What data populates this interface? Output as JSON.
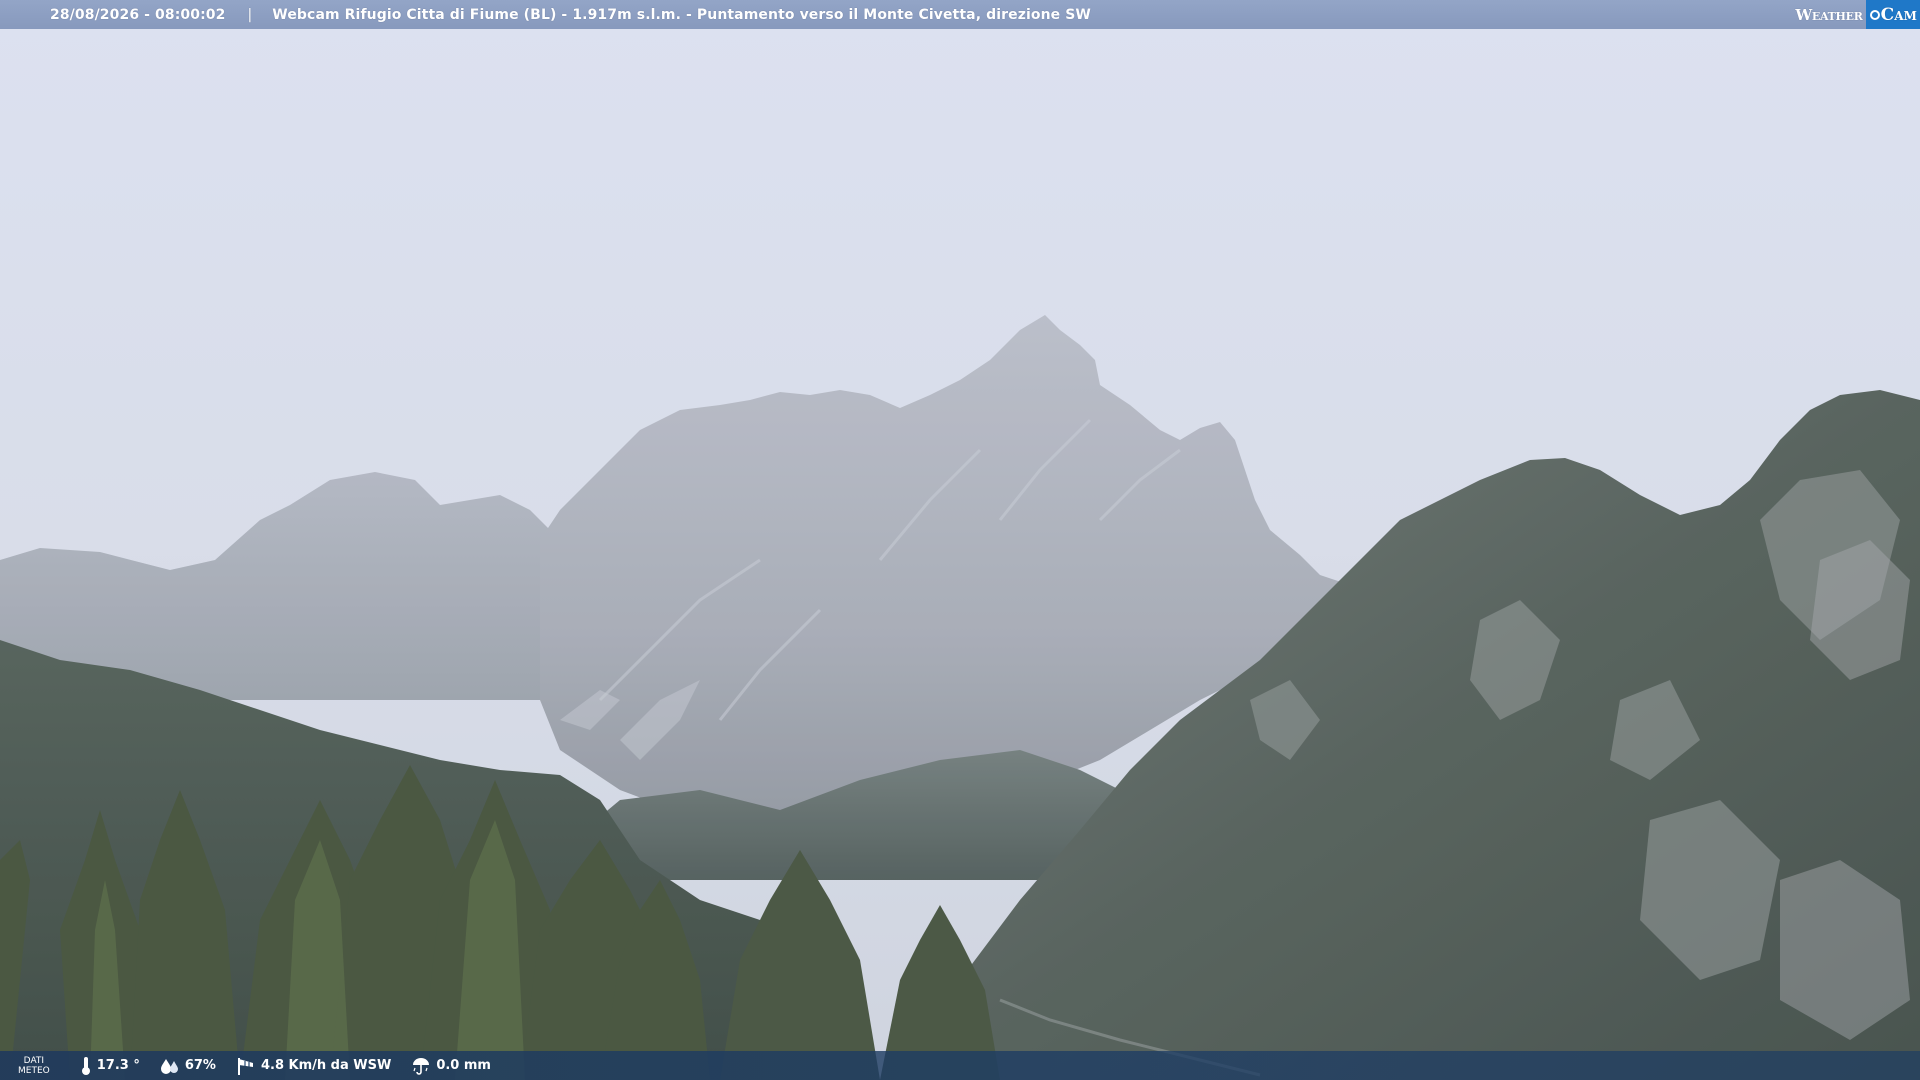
{
  "header": {
    "timestamp": "28/08/2026 - 08:00:02",
    "separator": "|",
    "caption": "Webcam Rifugio Citta di Fiume (BL) - 1.917m s.l.m. - Puntamento verso il Monte Civetta, direzione SW"
  },
  "brand": {
    "weather": "Weather",
    "cam": "Cam",
    "accent_color": "#1f78c8"
  },
  "footer": {
    "label_line1": "DATI",
    "label_line2": "METEO",
    "temperature": "17.3 °",
    "humidity": "67%",
    "wind": "4.8 Km/h da WSW",
    "rain": "0.0 mm"
  },
  "icons": {
    "temperature": "thermometer-icon",
    "humidity": "humidity-drops-icon",
    "wind": "wind-sock-icon",
    "rain": "rain-umbrella-icon"
  }
}
